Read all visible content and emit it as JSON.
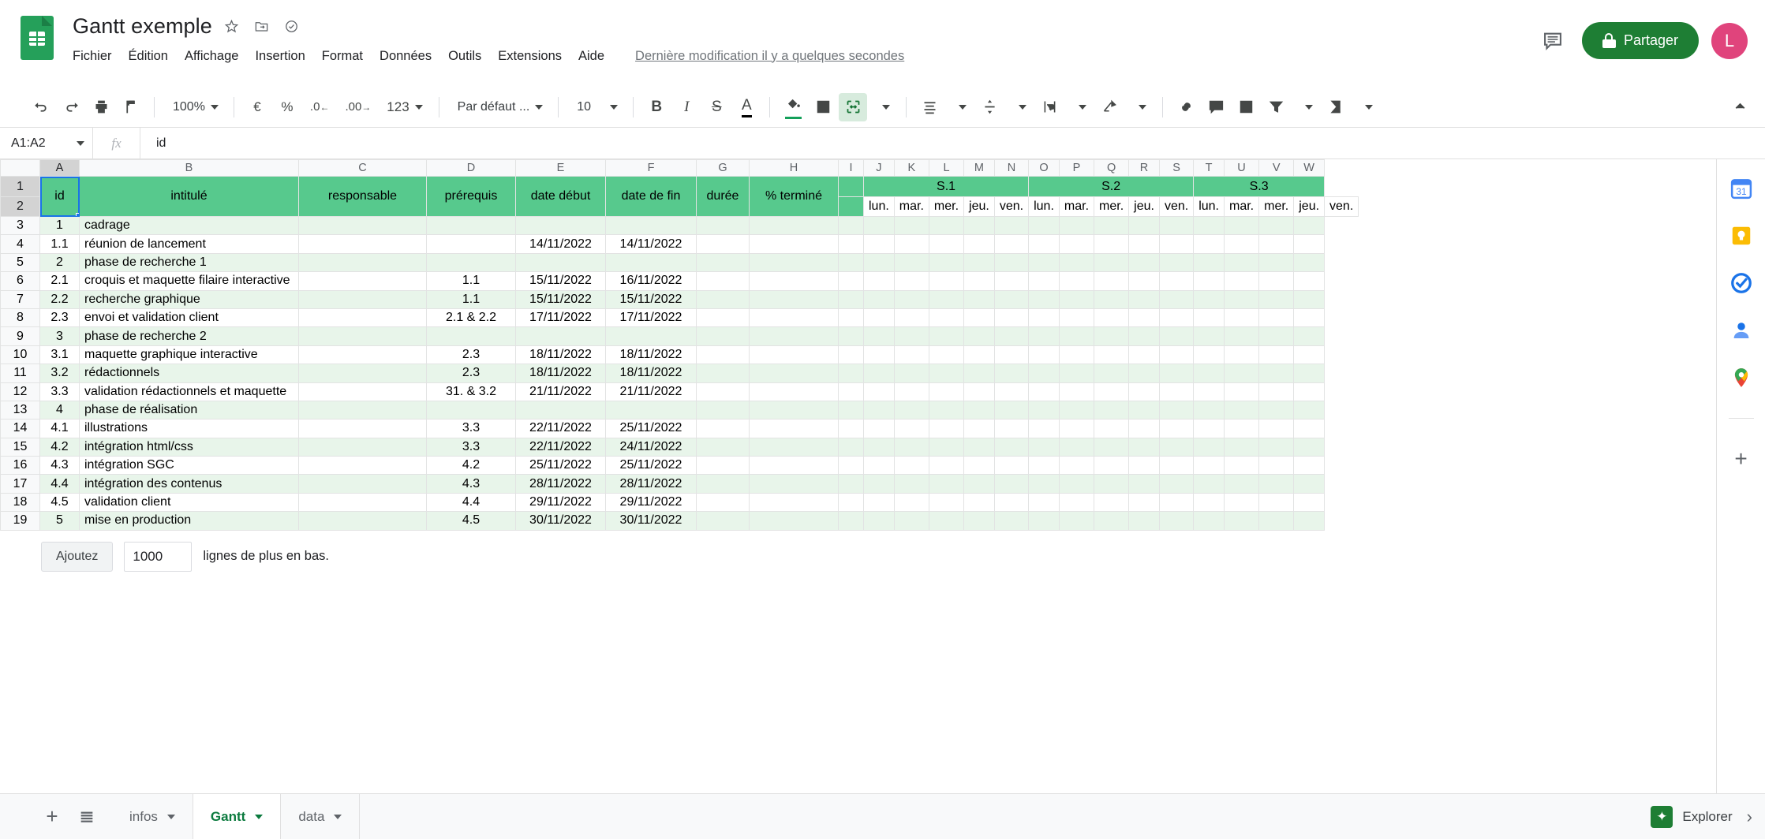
{
  "app": {
    "doc_title": "Gantt exemple",
    "last_modified": "Dernière modification il y a quelques secondes",
    "share_label": "Partager",
    "avatar_initial": "L",
    "accent_green": "#1e7e34",
    "header_fill": "#57c98d",
    "row_alt_fill": "#e8f5ea",
    "selection_blue": "#1a73e8",
    "avatar_color": "#e0447c"
  },
  "menu": {
    "items": [
      "Fichier",
      "Édition",
      "Affichage",
      "Insertion",
      "Format",
      "Données",
      "Outils",
      "Extensions",
      "Aide"
    ]
  },
  "title_icons": [
    "star-icon",
    "move-to-folder-icon",
    "cloud-saved-icon"
  ],
  "toolbar": {
    "zoom_value": "100%",
    "currency_symbol": "€",
    "percent_symbol": "%",
    "decimal_decrease": ".0",
    "decimal_increase": ".00",
    "number_format": "123",
    "font_name": "Par défaut ...",
    "font_size": "10",
    "bold": "B",
    "italic": "I",
    "strikethrough": "S",
    "text_color": "A",
    "icons": [
      "undo-icon",
      "redo-icon",
      "print-icon",
      "paint-format-icon",
      "fill-color-icon",
      "borders-icon",
      "merge-cells-icon",
      "horizontal-align-icon",
      "vertical-align-icon",
      "text-wrap-icon",
      "text-rotation-icon",
      "insert-link-icon",
      "add-comment-icon",
      "insert-chart-icon",
      "filter-icon",
      "functions-icon",
      "collapse-toolbar-icon"
    ]
  },
  "formula_bar": {
    "cell_reference": "A1:A2",
    "fx_label": "fx",
    "formula_value": "id"
  },
  "grid": {
    "column_letters": [
      "A",
      "B",
      "C",
      "D",
      "E",
      "F",
      "G",
      "H",
      "I",
      "J",
      "K",
      "L",
      "M",
      "N",
      "O",
      "P",
      "Q",
      "R",
      "S",
      "T",
      "U",
      "V",
      "W"
    ],
    "row_numbers": [
      "1",
      "2",
      "3",
      "4",
      "5",
      "6",
      "7",
      "8",
      "9",
      "10",
      "11",
      "12",
      "13",
      "14",
      "15",
      "16",
      "17",
      "18",
      "19"
    ],
    "selected_range": "A1:A2",
    "headers": {
      "id": "id",
      "intitule": "intitulé",
      "responsable": "responsable",
      "prerequis": "prérequis",
      "date_debut": "date début",
      "date_fin": "date de fin",
      "duree": "durée",
      "pct_termine": "% terminé"
    },
    "weeks": [
      "S.1",
      "S.2",
      "S.3"
    ],
    "days": [
      "lun.",
      "mar.",
      "mer.",
      "jeu.",
      "ven.",
      "lun.",
      "mar.",
      "mer.",
      "jeu.",
      "ven.",
      "lun.",
      "mar.",
      "mer.",
      "jeu.",
      "ven."
    ],
    "rows": [
      {
        "row": "3",
        "id": "1",
        "intitule": "cadrage",
        "responsable": "",
        "prerequis": "",
        "debut": "",
        "fin": "",
        "duree": "",
        "pct": ""
      },
      {
        "row": "4",
        "id": "1.1",
        "intitule": "réunion de lancement",
        "responsable": "",
        "prerequis": "",
        "debut": "14/11/2022",
        "fin": "14/11/2022",
        "duree": "",
        "pct": ""
      },
      {
        "row": "5",
        "id": "2",
        "intitule": "phase de recherche 1",
        "responsable": "",
        "prerequis": "",
        "debut": "",
        "fin": "",
        "duree": "",
        "pct": ""
      },
      {
        "row": "6",
        "id": "2.1",
        "intitule": "croquis et maquette filaire interactive",
        "responsable": "",
        "prerequis": "1.1",
        "debut": "15/11/2022",
        "fin": "16/11/2022",
        "duree": "",
        "pct": ""
      },
      {
        "row": "7",
        "id": "2.2",
        "intitule": "recherche graphique",
        "responsable": "",
        "prerequis": "1.1",
        "debut": "15/11/2022",
        "fin": "15/11/2022",
        "duree": "",
        "pct": ""
      },
      {
        "row": "8",
        "id": "2.3",
        "intitule": "envoi et validation client",
        "responsable": "",
        "prerequis": "2.1 & 2.2",
        "debut": "17/11/2022",
        "fin": "17/11/2022",
        "duree": "",
        "pct": ""
      },
      {
        "row": "9",
        "id": "3",
        "intitule": "phase de recherche 2",
        "responsable": "",
        "prerequis": "",
        "debut": "",
        "fin": "",
        "duree": "",
        "pct": ""
      },
      {
        "row": "10",
        "id": "3.1",
        "intitule": "maquette graphique interactive",
        "responsable": "",
        "prerequis": "2.3",
        "debut": "18/11/2022",
        "fin": "18/11/2022",
        "duree": "",
        "pct": ""
      },
      {
        "row": "11",
        "id": "3.2",
        "intitule": "rédactionnels",
        "responsable": "",
        "prerequis": "2.3",
        "debut": "18/11/2022",
        "fin": "18/11/2022",
        "duree": "",
        "pct": ""
      },
      {
        "row": "12",
        "id": "3.3",
        "intitule": "validation rédactionnels et maquette",
        "responsable": "",
        "prerequis": "31. & 3.2",
        "debut": "21/11/2022",
        "fin": "21/11/2022",
        "duree": "",
        "pct": ""
      },
      {
        "row": "13",
        "id": "4",
        "intitule": "phase de réalisation",
        "responsable": "",
        "prerequis": "",
        "debut": "",
        "fin": "",
        "duree": "",
        "pct": ""
      },
      {
        "row": "14",
        "id": "4.1",
        "intitule": "illustrations",
        "responsable": "",
        "prerequis": "3.3",
        "debut": "22/11/2022",
        "fin": "25/11/2022",
        "duree": "",
        "pct": ""
      },
      {
        "row": "15",
        "id": "4.2",
        "intitule": "intégration html/css",
        "responsable": "",
        "prerequis": "3.3",
        "debut": "22/11/2022",
        "fin": "24/11/2022",
        "duree": "",
        "pct": ""
      },
      {
        "row": "16",
        "id": "4.3",
        "intitule": "intégration SGC",
        "responsable": "",
        "prerequis": "4.2",
        "debut": "25/11/2022",
        "fin": "25/11/2022",
        "duree": "",
        "pct": ""
      },
      {
        "row": "17",
        "id": "4.4",
        "intitule": "intégration des contenus",
        "responsable": "",
        "prerequis": "4.3",
        "debut": "28/11/2022",
        "fin": "28/11/2022",
        "duree": "",
        "pct": ""
      },
      {
        "row": "18",
        "id": "4.5",
        "intitule": "validation client",
        "responsable": "",
        "prerequis": "4.4",
        "debut": "29/11/2022",
        "fin": "29/11/2022",
        "duree": "",
        "pct": ""
      },
      {
        "row": "19",
        "id": "5",
        "intitule": "mise en production",
        "responsable": "",
        "prerequis": "4.5",
        "debut": "30/11/2022",
        "fin": "30/11/2022",
        "duree": "",
        "pct": ""
      }
    ]
  },
  "add_rows": {
    "button_label": "Ajoutez",
    "count_value": "1000",
    "suffix_label": "lignes de plus en bas."
  },
  "sheet_tabs": {
    "add_sheet_icon": "add-sheet-icon",
    "all_sheets_icon": "all-sheets-icon",
    "tabs": [
      {
        "label": "infos",
        "active": false
      },
      {
        "label": "Gantt",
        "active": true
      },
      {
        "label": "data",
        "active": false
      }
    ]
  },
  "bottom_right": {
    "explorer_label": "Explorer"
  },
  "right_sidebar": {
    "icons": [
      "google-calendar-icon",
      "google-keep-icon",
      "google-tasks-icon",
      "google-contacts-icon",
      "google-maps-icon",
      "add-addon-icon"
    ]
  }
}
